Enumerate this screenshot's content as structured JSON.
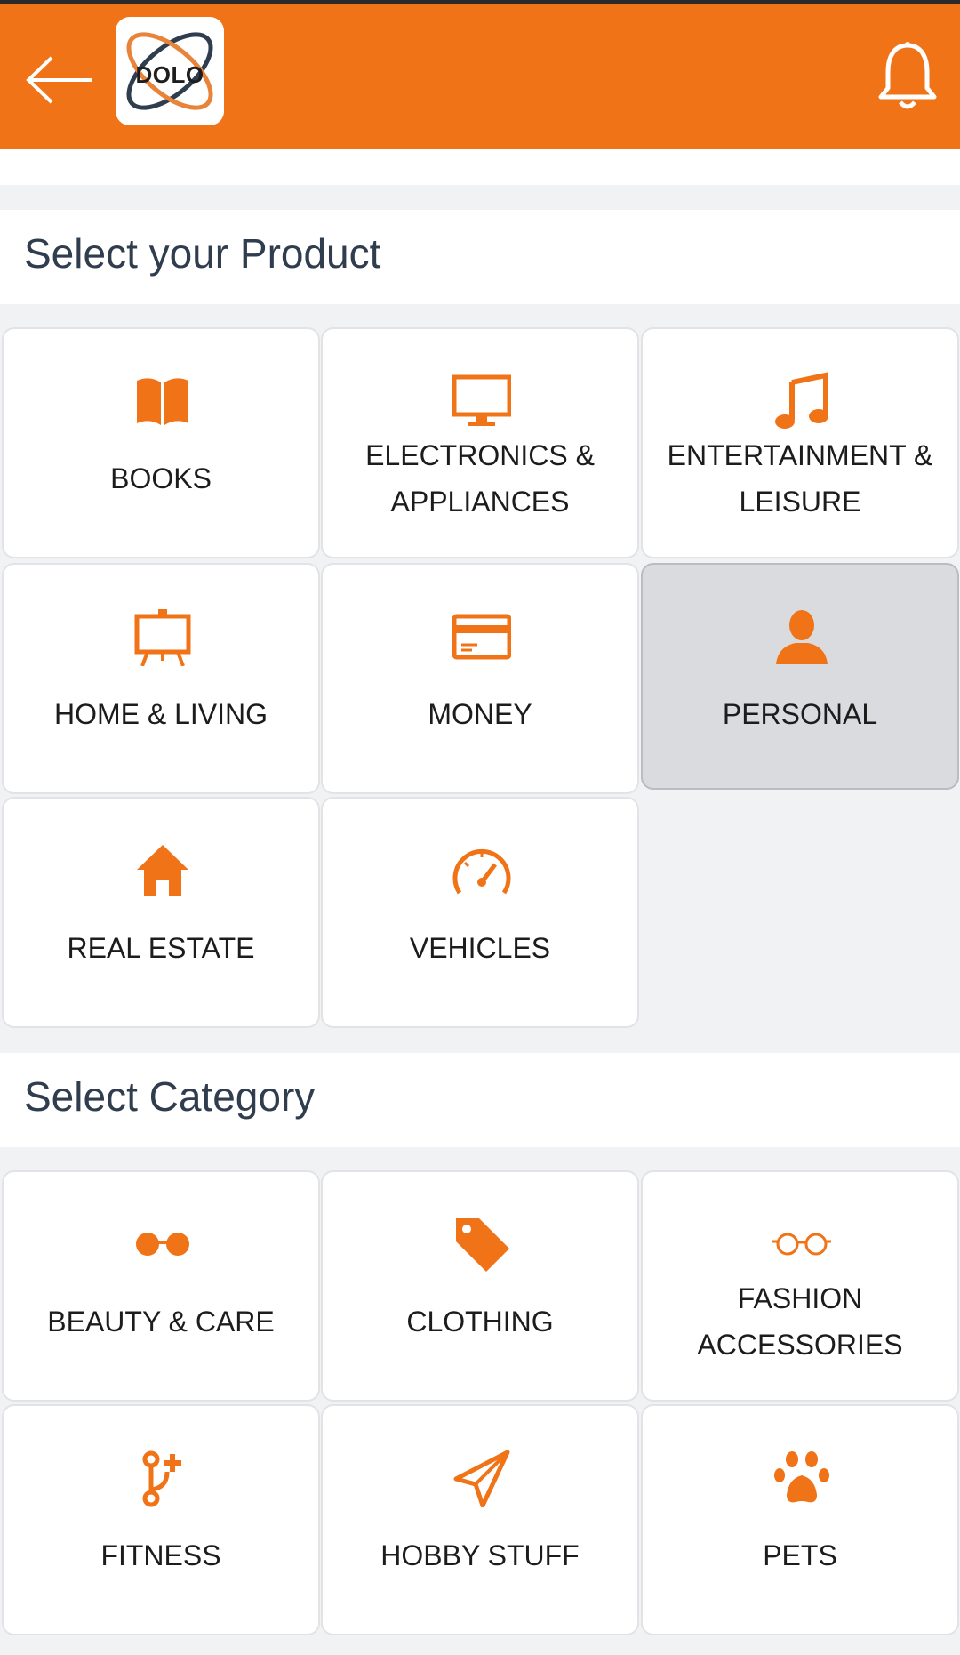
{
  "header": {
    "back_icon": "arrow-left-icon",
    "logo_text": "DOLO",
    "bell_icon": "bell-icon",
    "bar_color": "#f07317"
  },
  "product_section": {
    "title": "Select your Product",
    "items": [
      {
        "label": "BOOKS",
        "icon": "book-icon"
      },
      {
        "label": "ELECTRONICS & APPLIANCES",
        "icon": "monitor-icon"
      },
      {
        "label": "ENTERTAINMENT & LEISURE",
        "icon": "music-note-icon"
      },
      {
        "label": "HOME & LIVING",
        "icon": "easel-icon"
      },
      {
        "label": "MONEY",
        "icon": "credit-card-icon"
      },
      {
        "label": "PERSONAL",
        "icon": "person-icon",
        "selected": true
      },
      {
        "label": "REAL ESTATE",
        "icon": "house-icon"
      },
      {
        "label": "VEHICLES",
        "icon": "speedometer-icon"
      }
    ]
  },
  "category_section": {
    "title": "Select Category",
    "items": [
      {
        "label": "BEAUTY & CARE",
        "icon": "dumbbell-glasses-icon"
      },
      {
        "label": "CLOTHING",
        "icon": "tag-icon"
      },
      {
        "label": "FASHION ACCESSORIES",
        "icon": "eyeglasses-icon"
      },
      {
        "label": "FITNESS",
        "icon": "branch-plus-icon"
      },
      {
        "label": "HOBBY STUFF",
        "icon": "paper-plane-icon"
      },
      {
        "label": "PETS",
        "icon": "paw-icon"
      }
    ]
  },
  "accent_color": "#f07317",
  "selected_tile_color": "#d9dbde"
}
